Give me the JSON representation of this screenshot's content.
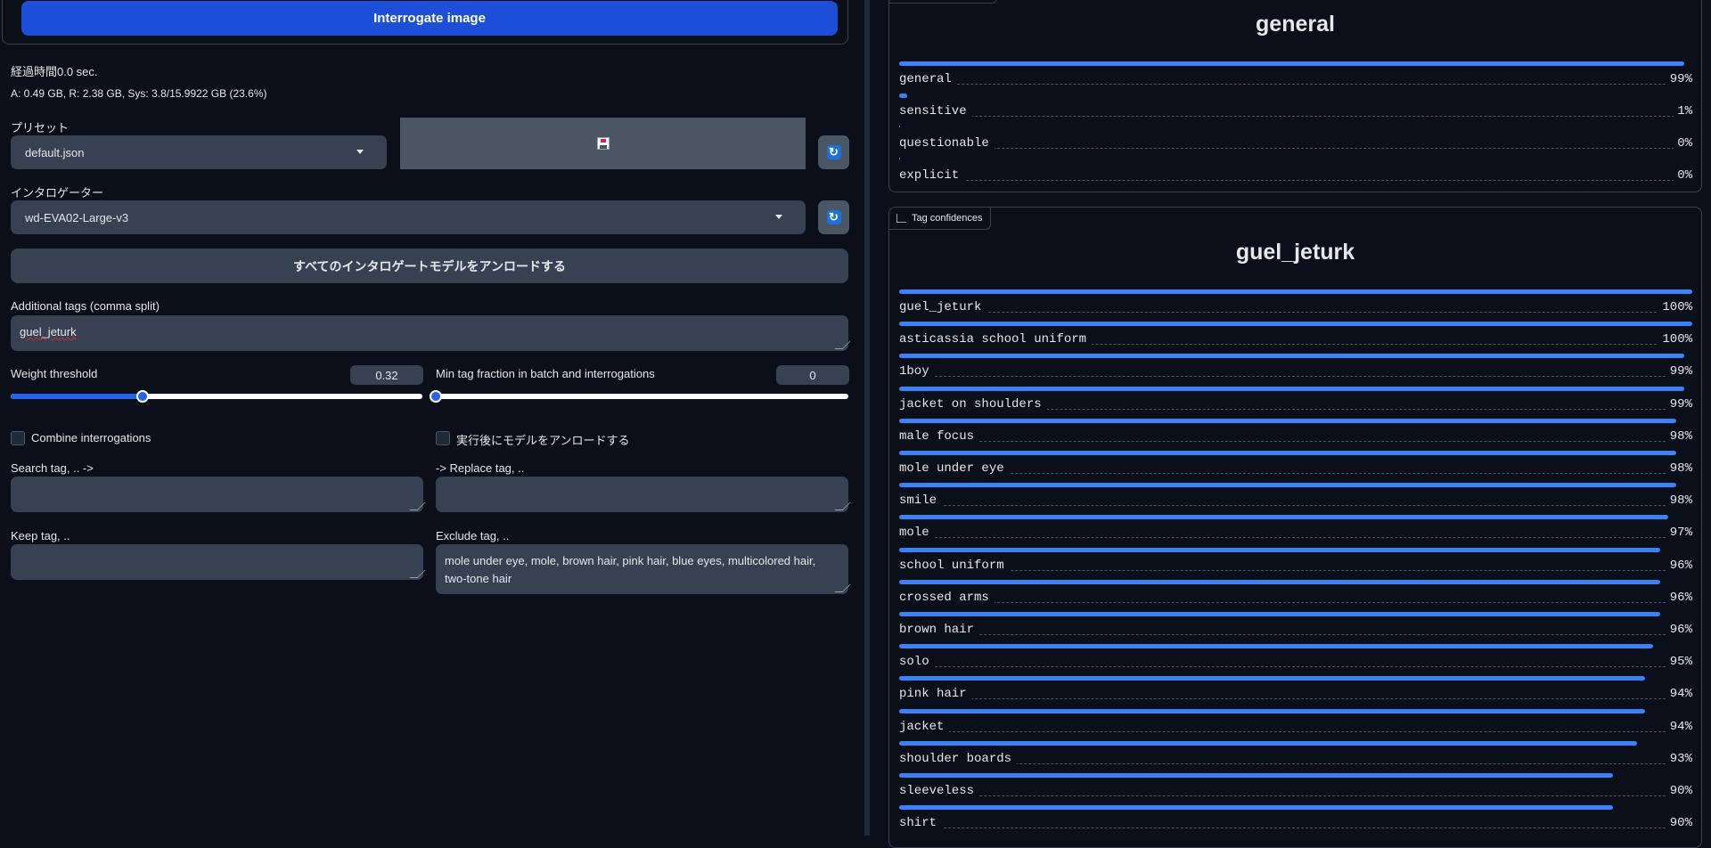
{
  "interrogate_button": "Interrogate image",
  "elapsed": "経過時間0.0 sec.",
  "memory": "A: 0.49 GB, R: 2.38 GB, Sys: 3.8/15.9922 GB (23.6%)",
  "preset": {
    "label": "プリセット",
    "value": "default.json"
  },
  "interrogator": {
    "label": "インタロゲーター",
    "value": "wd-EVA02-Large-v3"
  },
  "unload_all_button": "すべてのインタロゲートモデルをアンロードする",
  "additional_tags": {
    "label": "Additional tags (comma split)",
    "value": "guel_jeturk"
  },
  "weight_threshold": {
    "label": "Weight threshold",
    "value": "0.32",
    "fraction": 0.32
  },
  "min_tag_fraction": {
    "label": "Min tag fraction in batch and interrogations",
    "value": "0",
    "fraction": 0
  },
  "combine_label": "Combine interrogations",
  "unload_after_label": "実行後にモデルをアンロードする",
  "search_tag_label": "Search tag, .. ->",
  "replace_tag_label": "-> Replace tag, ..",
  "keep_tag_label": "Keep tag, ..",
  "exclude_tag": {
    "label": "Exclude tag, ..",
    "value": "mole under eye, mole, brown hair, pink hair, blue eyes, multicolored hair, two-tone hair"
  },
  "ratings": {
    "title": "general",
    "items": [
      {
        "label": "general",
        "pct": "99%",
        "value": 0.99
      },
      {
        "label": "sensitive",
        "pct": "1%",
        "value": 0.01
      },
      {
        "label": "questionable",
        "pct": "0%",
        "value": 0.0
      },
      {
        "label": "explicit",
        "pct": "0%",
        "value": 0.0
      }
    ]
  },
  "tags": {
    "tab_label": "Tag confidences",
    "title": "guel_jeturk",
    "items": [
      {
        "label": "guel_jeturk",
        "pct": "100%",
        "value": 1.0
      },
      {
        "label": "asticassia school uniform",
        "pct": "100%",
        "value": 1.0
      },
      {
        "label": "1boy",
        "pct": "99%",
        "value": 0.99
      },
      {
        "label": "jacket on shoulders",
        "pct": "99%",
        "value": 0.99
      },
      {
        "label": "male focus",
        "pct": "98%",
        "value": 0.98
      },
      {
        "label": "mole under eye",
        "pct": "98%",
        "value": 0.98
      },
      {
        "label": "smile",
        "pct": "98%",
        "value": 0.98
      },
      {
        "label": "mole",
        "pct": "97%",
        "value": 0.97
      },
      {
        "label": "school uniform",
        "pct": "96%",
        "value": 0.96
      },
      {
        "label": "crossed arms",
        "pct": "96%",
        "value": 0.96
      },
      {
        "label": "brown hair",
        "pct": "96%",
        "value": 0.96
      },
      {
        "label": "solo",
        "pct": "95%",
        "value": 0.95
      },
      {
        "label": "pink hair",
        "pct": "94%",
        "value": 0.94
      },
      {
        "label": "jacket",
        "pct": "94%",
        "value": 0.94
      },
      {
        "label": "shoulder boards",
        "pct": "93%",
        "value": 0.93
      },
      {
        "label": "sleeveless",
        "pct": "90%",
        "value": 0.9
      },
      {
        "label": "shirt",
        "pct": "90%",
        "value": 0.9
      }
    ]
  },
  "colors": {
    "accent": "#2563eb",
    "bar": "#3b82f6",
    "background": "#0b0f19",
    "input": "#374151"
  }
}
